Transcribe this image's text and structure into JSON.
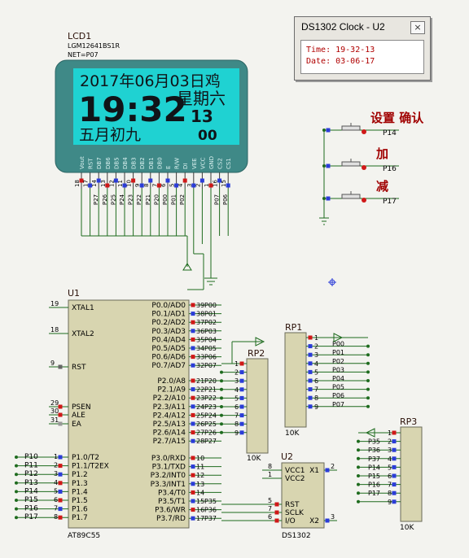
{
  "lcd": {
    "ref": "LCD1",
    "part": "LGM12641BS1R",
    "net": "NET=P07",
    "line1": "2017年06月03日鸡",
    "time": "19:32",
    "weekday": "星期六",
    "seconds": "13",
    "lunar": "五月初九",
    "extra": "00",
    "pins": [
      "Vout",
      "RST",
      "DB7",
      "DB6",
      "DB5",
      "DB4",
      "DB3",
      "DB2",
      "DB1",
      "DB0",
      "E",
      "R/W",
      "DI",
      "VEE",
      "VCC",
      "GND",
      "CS2",
      "CS1"
    ],
    "pin_numbers": [
      "18",
      "17",
      "14",
      "13",
      "12",
      "11",
      "10",
      "9",
      "8",
      "7",
      "6",
      "5",
      "4",
      "3",
      "2",
      "1",
      "16",
      "15"
    ],
    "nets": [
      "P27",
      "P26",
      "P25",
      "P24",
      "P23",
      "P22",
      "P21",
      "P20",
      "P00",
      "P01",
      "P02",
      "P07",
      "P06"
    ]
  },
  "ds1302_window": {
    "title": "DS1302 Clock - U2",
    "close": "×",
    "time_line": "Time:  19-32-13",
    "date_line": "Date:  03-06-17"
  },
  "buttons": [
    {
      "label": "设置 确认",
      "net": "P14"
    },
    {
      "label": "加",
      "net": "P16"
    },
    {
      "label": "减",
      "net": "P17"
    }
  ],
  "u1": {
    "ref": "U1",
    "part": "AT89C55",
    "left_pins": [
      {
        "num": "19",
        "name": "XTAL1"
      },
      {
        "num": "18",
        "name": "XTAL2"
      },
      {
        "num": "9",
        "name": "RST"
      },
      {
        "num": "29",
        "name": "PSEN"
      },
      {
        "num": "30",
        "name": "ALE"
      },
      {
        "num": "31",
        "name": "EA"
      }
    ],
    "left_p1": [
      {
        "net": "P10",
        "num": "1",
        "name": "P1.0/T2"
      },
      {
        "net": "P11",
        "num": "2",
        "name": "P1.1/T2EX"
      },
      {
        "net": "P12",
        "num": "3",
        "name": "P1.2"
      },
      {
        "net": "P13",
        "num": "4",
        "name": "P1.3"
      },
      {
        "net": "P14",
        "num": "5",
        "name": "P1.4"
      },
      {
        "net": "P15",
        "num": "6",
        "name": "P1.5"
      },
      {
        "net": "P16",
        "num": "7",
        "name": "P1.6"
      },
      {
        "net": "P17",
        "num": "8",
        "name": "P1.7"
      }
    ],
    "right_p0": [
      {
        "name": "P0.0/AD0",
        "num": "39",
        "net": "P00"
      },
      {
        "name": "P0.1/AD1",
        "num": "38",
        "net": "P01"
      },
      {
        "name": "P0.2/AD2",
        "num": "37",
        "net": "P02"
      },
      {
        "name": "P0.3/AD3",
        "num": "36",
        "net": "P03"
      },
      {
        "name": "P0.4/AD4",
        "num": "35",
        "net": "P04"
      },
      {
        "name": "P0.5/AD5",
        "num": "34",
        "net": "P05"
      },
      {
        "name": "P0.6/AD6",
        "num": "33",
        "net": "P06"
      },
      {
        "name": "P0.7/AD7",
        "num": "32",
        "net": "P07"
      }
    ],
    "right_p2": [
      {
        "name": "P2.0/A8",
        "num": "21",
        "net": "P20"
      },
      {
        "name": "P2.1/A9",
        "num": "22",
        "net": "P21"
      },
      {
        "name": "P2.2/A10",
        "num": "23",
        "net": "P22"
      },
      {
        "name": "P2.3/A11",
        "num": "24",
        "net": "P23"
      },
      {
        "name": "P2.4/A12",
        "num": "25",
        "net": "P24"
      },
      {
        "name": "P2.5/A13",
        "num": "26",
        "net": "P25"
      },
      {
        "name": "P2.6/A14",
        "num": "27",
        "net": "P26"
      },
      {
        "name": "P2.7/A15",
        "num": "28",
        "net": "P27"
      }
    ],
    "right_p3": [
      {
        "name": "P3.0/RXD",
        "num": "10",
        "net": ""
      },
      {
        "name": "P3.1/TXD",
        "num": "11",
        "net": ""
      },
      {
        "name": "P3.2/INT0",
        "num": "12",
        "net": ""
      },
      {
        "name": "P3.3/INT1",
        "num": "13",
        "net": ""
      },
      {
        "name": "P3.4/T0",
        "num": "14",
        "net": ""
      },
      {
        "name": "P3.5/T1",
        "num": "15",
        "net": "P35"
      },
      {
        "name": "P3.6/WR",
        "num": "16",
        "net": "P36"
      },
      {
        "name": "P3.7/RD",
        "num": "17",
        "net": "P37"
      }
    ]
  },
  "rp2": {
    "ref": "RP2",
    "value": "10K",
    "pins": [
      "1",
      "2",
      "3",
      "4",
      "5",
      "6",
      "7",
      "8",
      "9"
    ]
  },
  "rp1": {
    "ref": "RP1",
    "value": "10K",
    "pins": [
      "1",
      "2",
      "3",
      "4",
      "5",
      "6",
      "7",
      "8",
      "9"
    ],
    "nets": [
      "P00",
      "P01",
      "P02",
      "P03",
      "P04",
      "P05",
      "P06",
      "P07"
    ]
  },
  "rp3": {
    "ref": "RP3",
    "value": "10K",
    "pins": [
      "1",
      "2",
      "3",
      "4",
      "5",
      "6",
      "7",
      "8",
      "9"
    ],
    "nets": [
      "P35",
      "P36",
      "P37",
      "P14",
      "P15",
      "P16",
      "P17"
    ]
  },
  "u2": {
    "ref": "U2",
    "part": "DS1302",
    "left": [
      {
        "num": "8",
        "name": "VCC1"
      },
      {
        "num": "1",
        "name": "VCC2"
      },
      {
        "num": "5",
        "name": "RST"
      },
      {
        "num": "7",
        "name": "SCLK"
      },
      {
        "num": "6",
        "name": "I/O"
      }
    ],
    "right": [
      {
        "num": "2",
        "name": "X1"
      },
      {
        "num": "3",
        "name": "X2"
      }
    ]
  },
  "colors": {
    "lcd_frame": "#3f8987",
    "lcd_screen": "#1fd2d2",
    "wire": "#1e6b1e",
    "part_fill": "#d8d5b0",
    "pin_marker": "#2b3cd8",
    "pin_marker_red": "#d01818",
    "label": "#a00000"
  }
}
